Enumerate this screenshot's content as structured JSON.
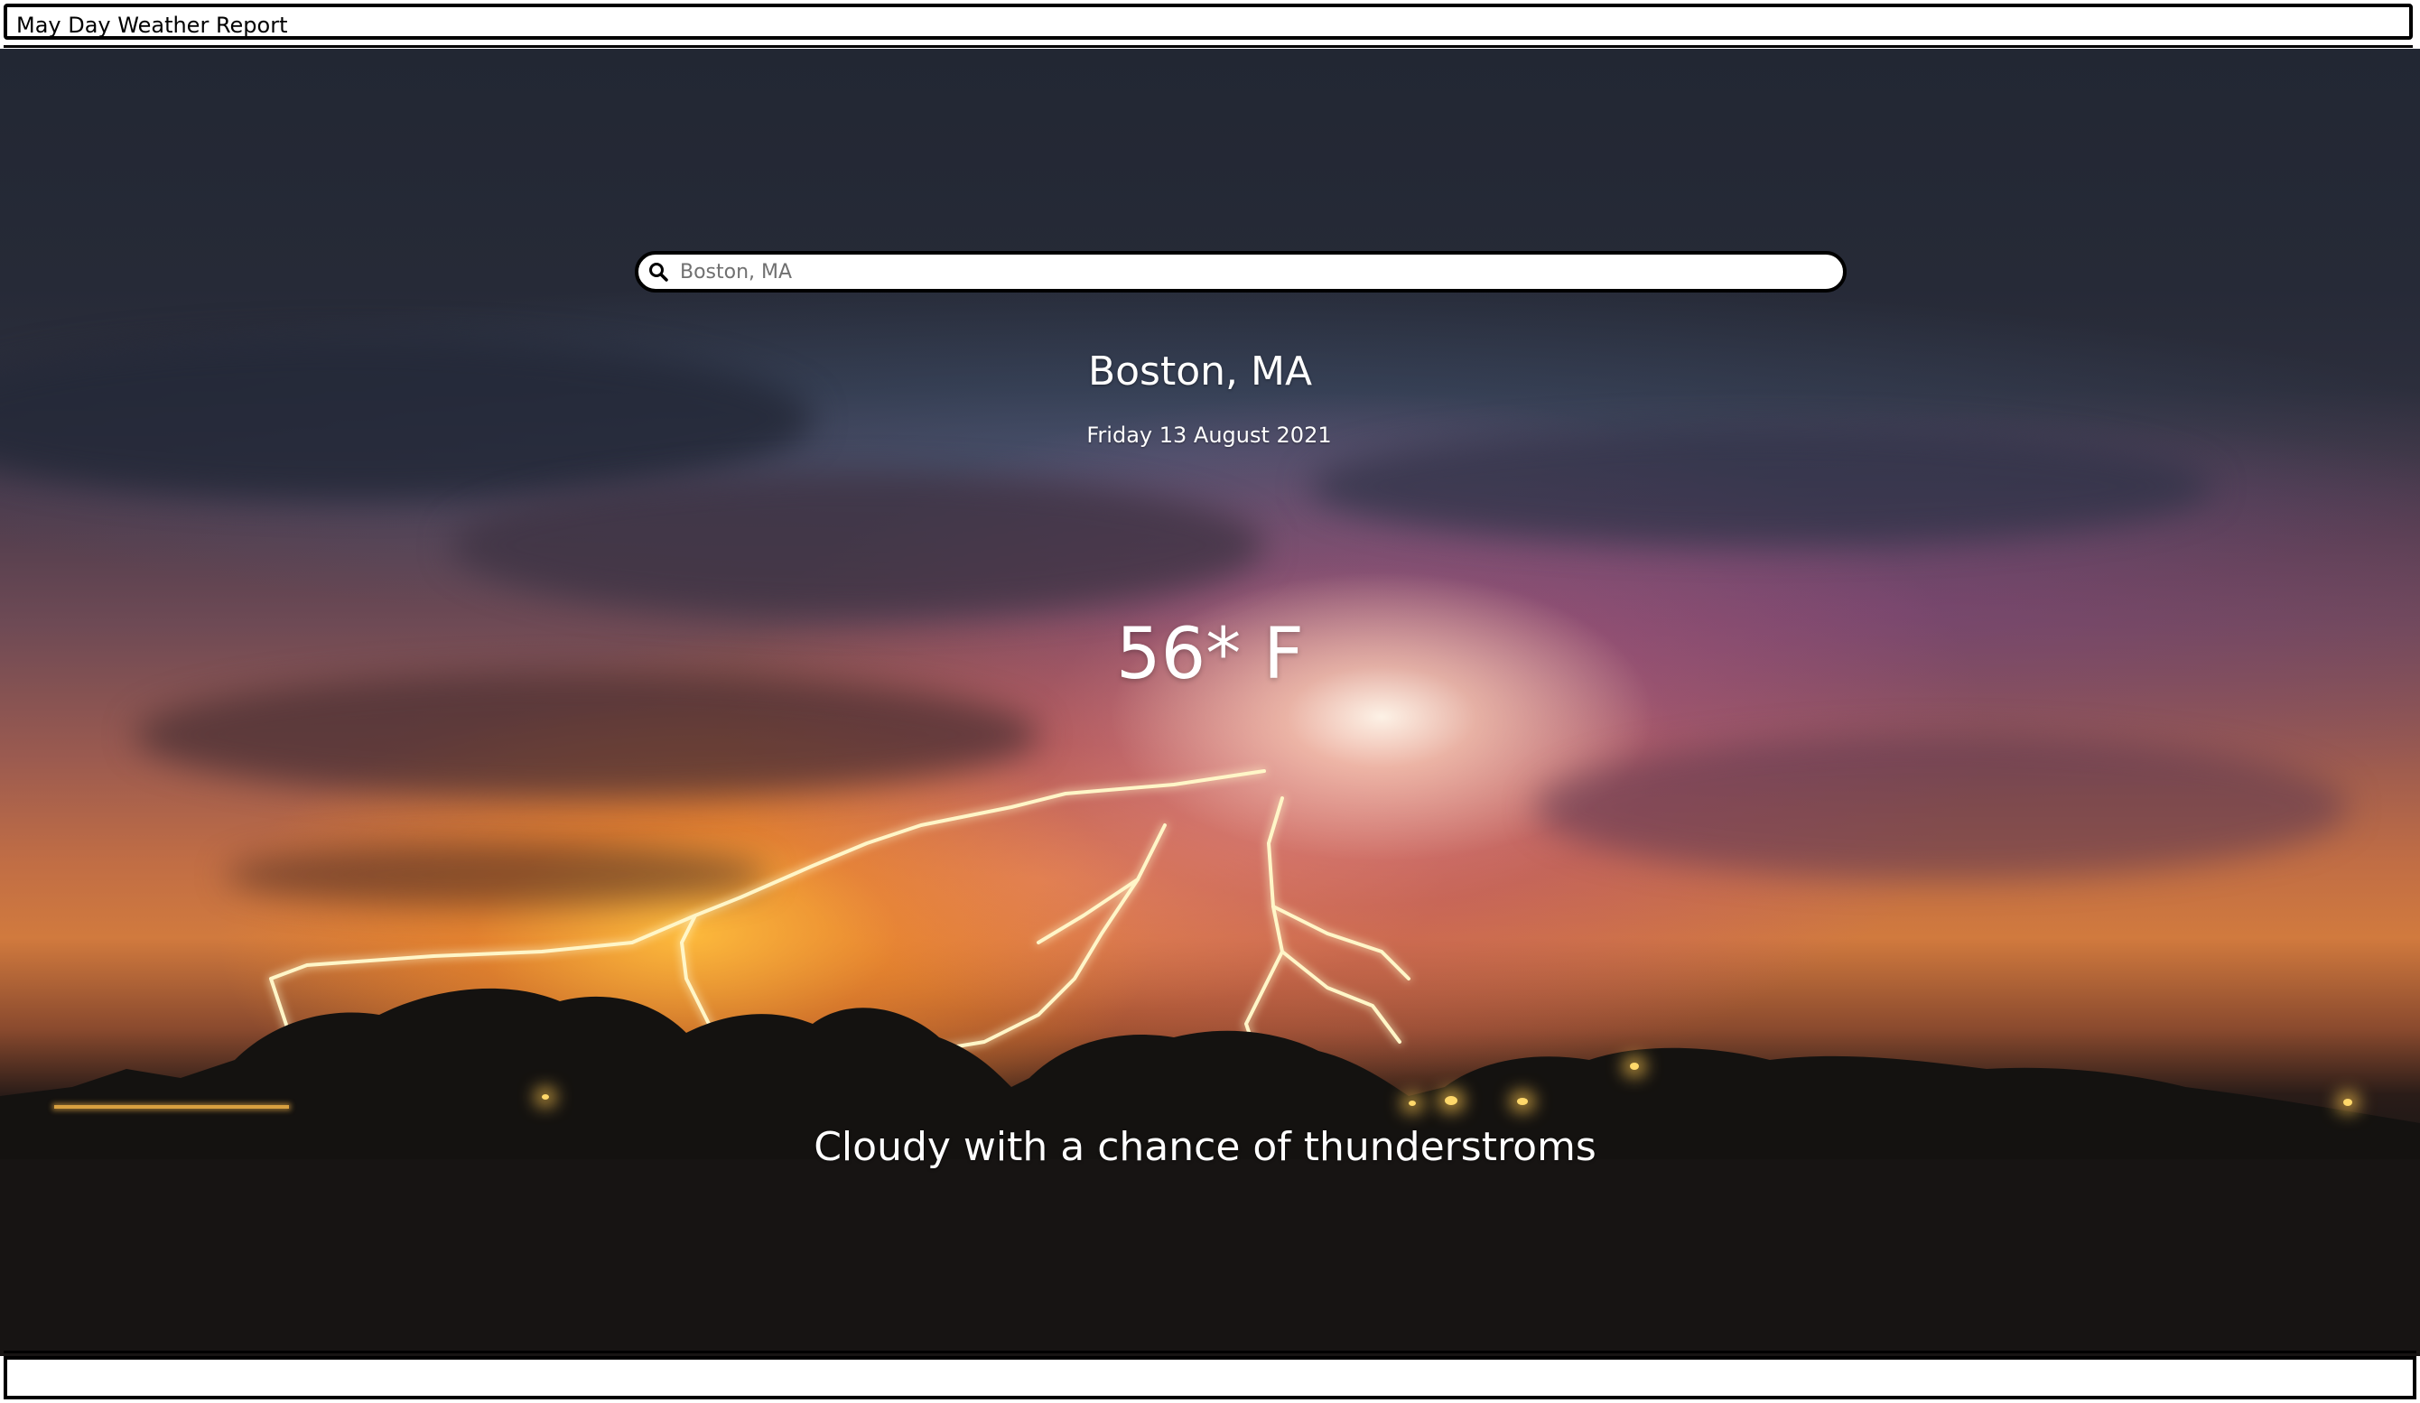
{
  "window": {
    "title": "May Day Weather Report"
  },
  "search": {
    "placeholder": "Boston, MA",
    "value": ""
  },
  "weather": {
    "location": "Boston, MA",
    "date": "Friday 13 August 2021",
    "temperature": "56* F",
    "description": "Cloudy with a chance of thunderstroms"
  },
  "icons": {
    "search": "search-icon"
  },
  "colors": {
    "bar_border": "#000000",
    "bar_background": "#ffffff",
    "text_on_image": "#ffffff",
    "placeholder": "#707070"
  }
}
